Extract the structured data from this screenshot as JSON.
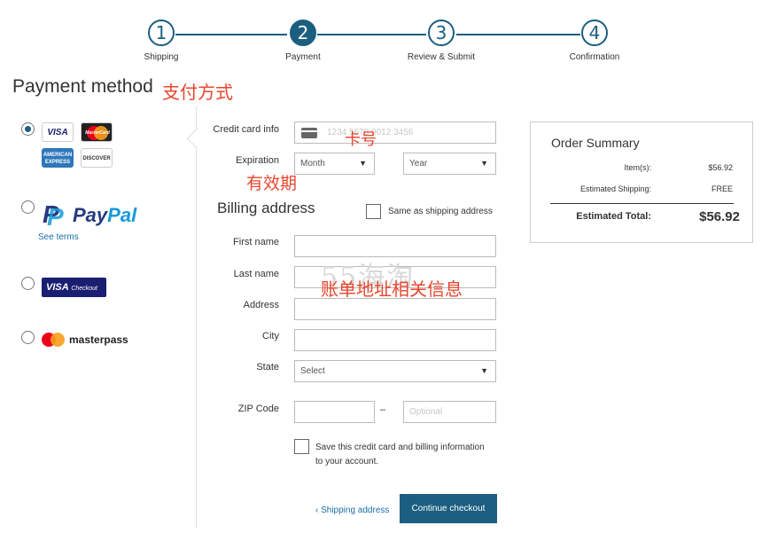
{
  "stepper": {
    "steps": [
      {
        "number": "1",
        "label": "Shipping"
      },
      {
        "number": "2",
        "label": "Payment"
      },
      {
        "number": "3",
        "label": "Review & Submit"
      },
      {
        "number": "4",
        "label": "Confirmation"
      }
    ],
    "active_step": "2"
  },
  "page_title": "Payment method",
  "annotations": {
    "payment_method": "支付方式",
    "card_number": "卡号",
    "expiration": "有效期",
    "billing_info": "账单地址相关信息"
  },
  "watermark": "55海淘",
  "payment_options": {
    "credit_card": {
      "selected": true,
      "logos": [
        "VISA",
        "MasterCard",
        "AMERICAN EXPRESS",
        "DISCOVER"
      ]
    },
    "paypal": {
      "pay": "Pay",
      "pal": "Pal",
      "see_terms": "See terms"
    },
    "visa_checkout": {
      "visa": "VISA",
      "checkout": "Checkout"
    },
    "masterpass": {
      "label": "masterpass"
    }
  },
  "form": {
    "credit_card_label": "Credit card info",
    "credit_card_placeholder": "1234 5678 9012 3456",
    "expiration_label": "Expiration",
    "month_value": "Month",
    "year_value": "Year",
    "billing_title": "Billing address",
    "same_as_shipping": "Same as shipping address",
    "first_name_label": "First name",
    "last_name_label": "Last name",
    "address_label": "Address",
    "city_label": "City",
    "state_label": "State",
    "state_value": "Select",
    "zip_label": "ZIP Code",
    "zip_ext_placeholder": "Optional",
    "zip_dash": "–",
    "save_info_line1": "Save this credit card and billing information",
    "save_info_line2": "to your account.",
    "back_link": "‹ Shipping address",
    "continue_button": "Continue checkout"
  },
  "summary": {
    "title": "Order Summary",
    "items_label": "Item(s):",
    "items_value": "$56.92",
    "shipping_label": "Estimated Shipping:",
    "shipping_value": "FREE",
    "total_label": "Estimated Total:",
    "total_value": "$56.92"
  },
  "colors": {
    "primary": "#1b5e80",
    "link": "#1b6ea8",
    "annotation": "#e8462d"
  }
}
